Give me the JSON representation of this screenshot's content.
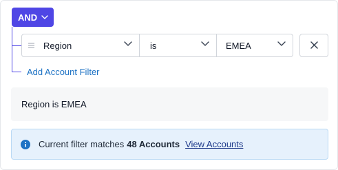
{
  "group": {
    "operator_label": "AND"
  },
  "filter_row": {
    "field": "Region",
    "operator": "is",
    "value": "EMEA"
  },
  "add_filter_label": "Add Account Filter",
  "summary_text": "Region is EMEA",
  "info_banner": {
    "prefix": "Current filter matches",
    "count_text": "48 Accounts",
    "link_label": "View Accounts"
  },
  "icons": {
    "group_dropdown": "chevron-down-icon",
    "field_drag": "drag-handle-icon",
    "remove": "close-icon",
    "info": "info-icon"
  },
  "colors": {
    "accent": "#4f46e5",
    "link": "#1d72c4",
    "info_bg": "#e6f1fc",
    "info_icon": "#1d72c4"
  }
}
